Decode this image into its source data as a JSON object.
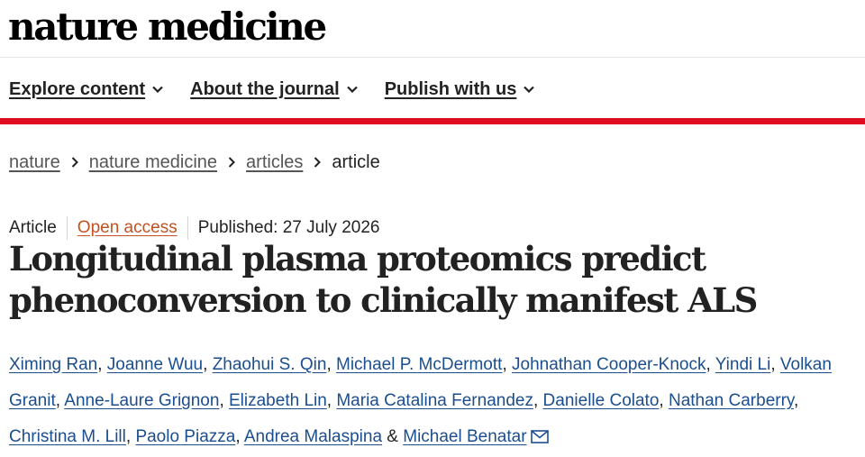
{
  "site": {
    "logo": "nature medicine"
  },
  "nav": {
    "items": [
      {
        "label": "Explore content"
      },
      {
        "label": "About the journal"
      },
      {
        "label": "Publish with us"
      }
    ]
  },
  "breadcrumb": {
    "items": [
      "nature",
      "nature medicine",
      "articles"
    ],
    "current": "article"
  },
  "article": {
    "type": "Article",
    "access": "Open access",
    "published": "Published: 27 July 2026",
    "title": "Longitudinal plasma proteomics predict phenoconversion to clinically manifest ALS",
    "authors": [
      "Ximing Ran",
      "Joanne Wuu",
      "Zhaohui S. Qin",
      "Michael P. McDermott",
      "Johnathan Cooper-Knock",
      "Yindi Li",
      "Volkan Granit",
      "Anne-Laure Grignon",
      "Elizabeth Lin",
      "Maria Catalina Fernandez",
      "Danielle Colato",
      "Nathan Carberry",
      "Christina M. Lill",
      "Paolo Piazza",
      "Andrea Malaspina",
      "Michael Benatar"
    ],
    "author_separator": ", ",
    "last_author_joiner": " & ",
    "corresponding_icon": "mail-icon"
  },
  "colors": {
    "accent_bar": "#e00d22",
    "open_access": "#c4511f",
    "author_link": "#1b4e8f"
  }
}
